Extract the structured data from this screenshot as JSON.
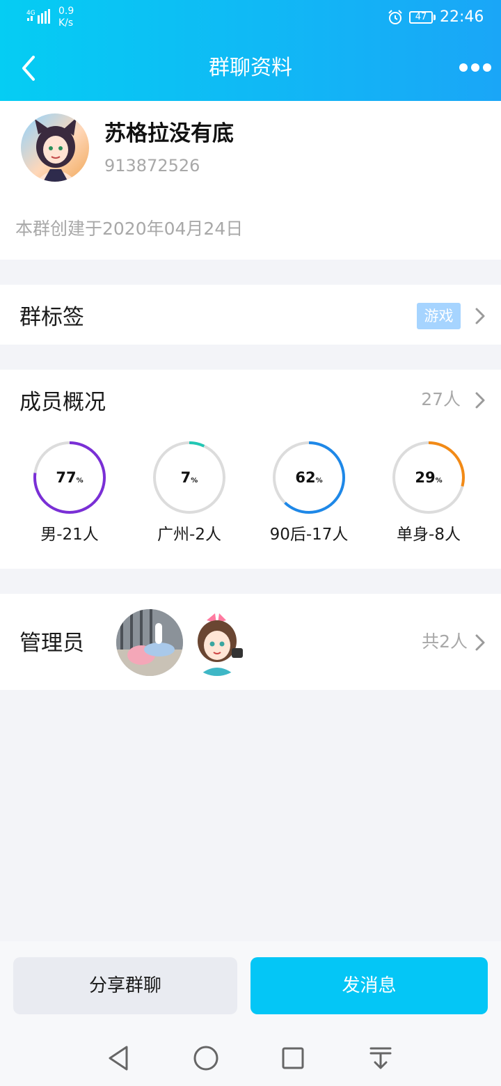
{
  "status_bar": {
    "network_type": "4G",
    "speed_value": "0.9",
    "speed_unit": "K/s",
    "battery": "47",
    "time": "22:46"
  },
  "header": {
    "title": "群聊资料"
  },
  "group": {
    "name": "苏格拉没有底",
    "id": "913872526",
    "created": "本群创建于2020年04月24日"
  },
  "tag_row": {
    "label": "群标签",
    "tag": "游戏"
  },
  "members": {
    "label": "成员概况",
    "count": "27人",
    "stats": [
      {
        "value": "77",
        "unit": "%",
        "fraction": 0.77,
        "label": "男-21人",
        "color": "#7a2fd6"
      },
      {
        "value": "7",
        "unit": "%",
        "fraction": 0.07,
        "label": "广州-2人",
        "color": "#22c7b4"
      },
      {
        "value": "62",
        "unit": "%",
        "fraction": 0.62,
        "label": "90后-17人",
        "color": "#1e88e8"
      },
      {
        "value": "29",
        "unit": "%",
        "fraction": 0.29,
        "label": "单身-8人",
        "color": "#f28a16"
      }
    ]
  },
  "admins": {
    "label": "管理员",
    "count": "共2人"
  },
  "actions": {
    "share": "分享群聊",
    "send": "发消息"
  },
  "icons": {
    "back": "chevron-left-icon",
    "more": "more-dots-icon",
    "chevron": "chevron-right-icon",
    "nav_back": "triangle-back-icon",
    "nav_home": "circle-home-icon",
    "nav_recent": "square-recent-icon",
    "nav_notify": "pull-down-icon"
  }
}
